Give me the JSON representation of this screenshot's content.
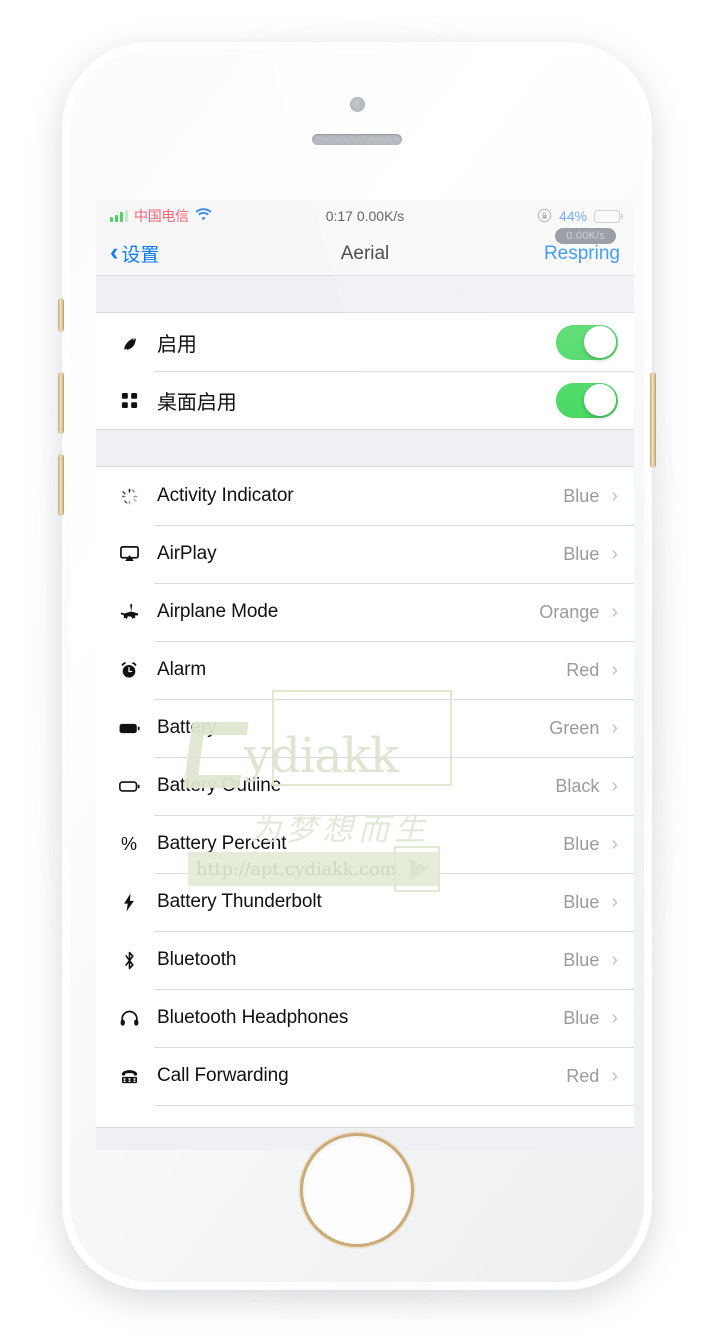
{
  "status_bar": {
    "carrier": "中国电信",
    "signal_icon": "signal-bars-icon",
    "wifi_icon": "wifi-icon",
    "center_text": "0:17 0.00K/s",
    "rotation_lock_icon": "rotation-lock-icon",
    "battery_percent": "44%",
    "battery_level": 44,
    "battery_icon": "battery-icon",
    "speed_badge": "0.00K/s",
    "colors": {
      "carrier": "#f2647a",
      "signal": "#4cd263",
      "wifi": "#3f8bf0",
      "battery_text": "#3f8bf0",
      "battery_fill": "#4cd263"
    }
  },
  "navbar": {
    "back_label": "设置",
    "back_icon": "chevron-left-icon",
    "title": "Aerial",
    "action_label": "Respring",
    "tint": "#0b7cff"
  },
  "toggles_section": {
    "rows": [
      {
        "icon": "feather-icon",
        "label": "启用",
        "on": true
      },
      {
        "icon": "grid-dots-icon",
        "label": "桌面启用",
        "on": true
      }
    ]
  },
  "items_section": {
    "rows": [
      {
        "icon": "activity-spinner-icon",
        "label": "Activity Indicator",
        "value": "Blue"
      },
      {
        "icon": "airplay-icon",
        "label": "AirPlay",
        "value": "Blue"
      },
      {
        "icon": "airplane-icon",
        "label": "Airplane Mode",
        "value": "Orange"
      },
      {
        "icon": "alarm-clock-icon",
        "label": "Alarm",
        "value": "Red"
      },
      {
        "icon": "battery-filled-icon",
        "label": "Battery",
        "value": "Green"
      },
      {
        "icon": "battery-outline-icon",
        "label": "Battery Outline",
        "value": "Black"
      },
      {
        "icon": "percent-icon",
        "label": "Battery Percent",
        "value": "Blue"
      },
      {
        "icon": "thunderbolt-icon",
        "label": "Battery Thunderbolt",
        "value": "Blue"
      },
      {
        "icon": "bluetooth-icon",
        "label": "Bluetooth",
        "value": "Blue"
      },
      {
        "icon": "headphones-icon",
        "label": "Bluetooth Headphones",
        "value": "Blue"
      },
      {
        "icon": "telephone-icon",
        "label": "Call Forwarding",
        "value": "Red"
      }
    ],
    "chevron_icon": "chevron-right-icon"
  },
  "watermark": {
    "logo_text": "ydiakk",
    "tagline": "为梦想而生",
    "url": "http://apt.cydiakk.com",
    "play_icon": "play-triangle-icon",
    "color": "#dde5d0"
  },
  "device": {
    "frame_color": "#d9bf92",
    "camera_icon": "front-camera-icon",
    "speaker_icon": "earpiece-speaker-icon",
    "home_button_icon": "home-button-icon"
  }
}
